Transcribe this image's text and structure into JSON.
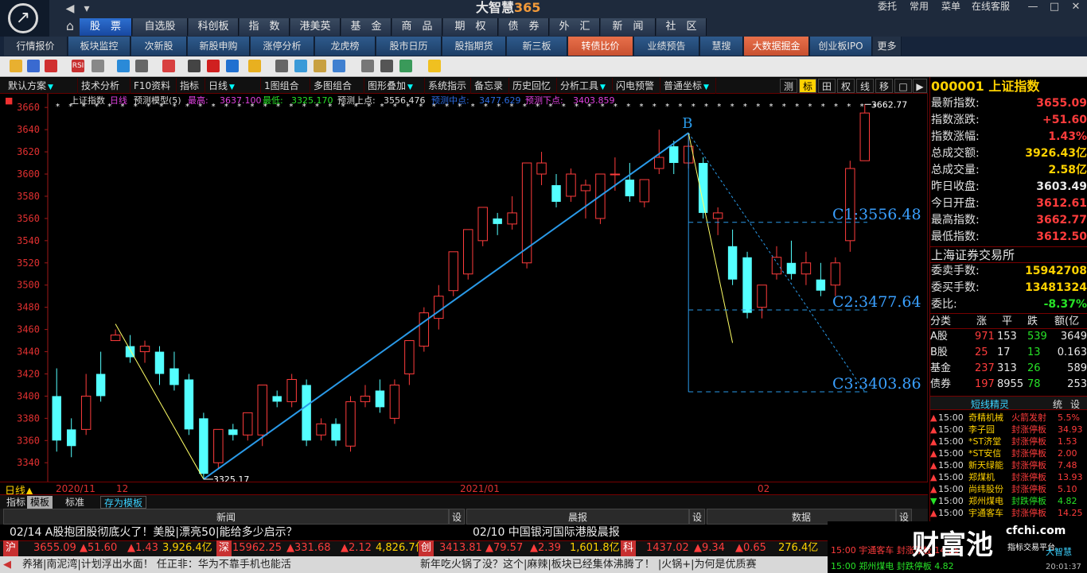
{
  "app": {
    "title_main": "大智慧",
    "title_num": "365",
    "menus": [
      "委托",
      "常用",
      "菜单",
      "在线客服"
    ]
  },
  "nav_tabs": [
    "股　票",
    "自选股",
    "科创板",
    "指　数",
    "港美英",
    "基　金",
    "商　品",
    "期　权",
    "债　券",
    "外　汇",
    "新　闻",
    "社　区"
  ],
  "sub_tabs": [
    "行情报价",
    "板块监控",
    "次新股",
    "新股申购",
    "涨停分析",
    "龙虎榜",
    "股市日历",
    "股指期货",
    "新三板",
    "转债比价",
    "业绩预告",
    "慧搜",
    "大数据掘金",
    "创业板IPO",
    "更多"
  ],
  "chart_toolbar": {
    "items": [
      "默认方案",
      "技术分析",
      "F10资料",
      "指标",
      "日线",
      "1图组合",
      "多图组合",
      "图形叠加",
      "系统指示",
      "备忘录",
      "历史回忆",
      "分析工具",
      "闪电预警",
      "普通坐标"
    ],
    "right_buttons": [
      "测",
      "标",
      "田",
      "权",
      "线",
      "移",
      "□",
      "▶"
    ]
  },
  "chart_header": {
    "name": "上证指数",
    "period": "日线",
    "model": "预测模型(5)",
    "high_label": "最高:",
    "high_val": "3637.100",
    "low_label": "最低:",
    "low_val": "3325.170",
    "up_label": "预测上点:",
    "up_val": "3556.476",
    "mid_label": "预测中点:",
    "mid_val": "3477.629",
    "down_label": "预测下点:",
    "down_val": "3403.859"
  },
  "chart_data": {
    "type": "candlestick",
    "y_ticks": [
      3340,
      3360,
      3380,
      3400,
      3420,
      3440,
      3460,
      3480,
      3500,
      3520,
      3540,
      3560,
      3580,
      3600,
      3620,
      3640,
      3660
    ],
    "ylim": [
      3323,
      3668
    ],
    "x_labels": [
      {
        "text": "日线▲",
        "i": 0
      },
      {
        "text": "2020/11",
        "i": 0
      },
      {
        "text": "12",
        "i": 4
      },
      {
        "text": "2021/01",
        "i": 28
      },
      {
        "text": "02",
        "i": 48
      }
    ],
    "candles": [
      [
        3400,
        3425,
        3360,
        3350
      ],
      [
        3370,
        3380,
        3355,
        3345
      ],
      [
        3370,
        3420,
        3400,
        3365
      ],
      [
        3420,
        3440,
        3400,
        3395
      ],
      [
        3450,
        3460,
        3455,
        3450
      ],
      [
        3445,
        3455,
        3435,
        3430
      ],
      [
        3440,
        3450,
        3445,
        3430
      ],
      [
        3440,
        3445,
        3420,
        3410
      ],
      [
        3425,
        3440,
        3410,
        3405
      ],
      [
        3415,
        3420,
        3370,
        3365
      ],
      [
        3380,
        3385,
        3330,
        3325
      ],
      [
        3340,
        3360,
        3370,
        3335
      ],
      [
        3370,
        3375,
        3365,
        3360
      ],
      [
        3365,
        3375,
        3385,
        3360
      ],
      [
        3365,
        3375,
        3410,
        3355
      ],
      [
        3400,
        3405,
        3395,
        3390
      ],
      [
        3395,
        3420,
        3415,
        3390
      ],
      [
        3410,
        3415,
        3360,
        3355
      ],
      [
        3365,
        3380,
        3375,
        3360
      ],
      [
        3375,
        3380,
        3360,
        3355
      ],
      [
        3355,
        3400,
        3395,
        3350
      ],
      [
        3395,
        3410,
        3400,
        3390
      ],
      [
        3405,
        3415,
        3390,
        3385
      ],
      [
        3380,
        3415,
        3410,
        3375
      ],
      [
        3420,
        3450,
        3450,
        3410
      ],
      [
        3445,
        3480,
        3475,
        3440
      ],
      [
        3470,
        3500,
        3490,
        3460
      ],
      [
        3495,
        3525,
        3530,
        3490
      ],
      [
        3510,
        3550,
        3550,
        3505
      ],
      [
        3540,
        3570,
        3570,
        3535
      ],
      [
        3560,
        3565,
        3555,
        3545
      ],
      [
        3555,
        3580,
        3565,
        3550
      ],
      [
        3520,
        3600,
        3610,
        3515
      ],
      [
        3600,
        3620,
        3610,
        3590
      ],
      [
        3590,
        3600,
        3575,
        3570
      ],
      [
        3580,
        3605,
        3600,
        3575
      ],
      [
        3585,
        3595,
        3590,
        3560
      ],
      [
        3560,
        3580,
        3600,
        3555
      ],
      [
        3600,
        3615,
        3600,
        3585
      ],
      [
        3595,
        3610,
        3580,
        3575
      ],
      [
        3575,
        3595,
        3595,
        3570
      ],
      [
        3605,
        3640,
        3615,
        3600
      ],
      [
        3625,
        3630,
        3610,
        3600
      ],
      [
        3610,
        3637,
        3625,
        3605
      ],
      [
        3610,
        3615,
        3565,
        3560
      ],
      [
        3560,
        3570,
        3565,
        3545
      ],
      [
        3535,
        3550,
        3505,
        3500
      ],
      [
        3525,
        3530,
        3475,
        3470
      ],
      [
        3480,
        3500,
        3500,
        3470
      ],
      [
        3510,
        3535,
        3525,
        3505
      ],
      [
        3520,
        3540,
        3510,
        3505
      ],
      [
        3510,
        3530,
        3520,
        3500
      ],
      [
        3505,
        3520,
        3495,
        3490
      ],
      [
        3500,
        3525,
        3520,
        3490
      ],
      [
        3540,
        3612,
        3605,
        3530
      ],
      [
        3612,
        3663,
        3655,
        3612
      ]
    ],
    "annotations": {
      "A": "A",
      "B": "B",
      "c1": "C1:3556.48",
      "c2": "C2:3477.64",
      "c3": "C3:3403.86",
      "high_tag": "3662.77",
      "low_tag": "3325.17"
    }
  },
  "indicator_tabs": [
    "指标",
    "模板",
    "标准",
    "存为模板"
  ],
  "news": {
    "tabs": [
      "新闻",
      "设",
      "晨报",
      "设",
      "数据",
      "设"
    ],
    "line1": "02/14  A股抱团股彻底火了！美股|漂亮50|能给多少启示？",
    "line2": "02/10  中国银河国际港股晨报"
  },
  "ticker": {
    "sh_label": "沪",
    "sh": {
      "price": "3655.09",
      "chg": "51.60",
      "pct": "1.43",
      "amt": "3,926.4亿"
    },
    "sz_label": "深",
    "sz": {
      "price": "15962.25",
      "chg": "331.68",
      "pct": "2.12",
      "amt": "4,826.7亿"
    },
    "cy_label": "创",
    "cy": {
      "price": "3413.81",
      "chg": "79.57",
      "pct": "2.39",
      "amt": "1,601.8亿"
    },
    "kc_label": "科",
    "kc": {
      "price": "1437.02",
      "chg": "9.34",
      "pct": "0.65",
      "amt": "276.4亿"
    }
  },
  "scroll_news": {
    "left": "养猪|南泥湾|计划浮出水面！  任正非：华为不靠手机也能活",
    "right": "新年吃火锅了没？这个|麻辣|板块已经集体沸腾了！  |火锅+|为何是优质赛"
  },
  "right_panel": {
    "title": "000001 上证指数",
    "rows": [
      {
        "k": "最新指数:",
        "v": "3655.09",
        "c": "red"
      },
      {
        "k": "指数涨跌:",
        "v": "+51.60",
        "c": "red"
      },
      {
        "k": "指数涨幅:",
        "v": "1.43%",
        "c": "red"
      },
      {
        "k": "总成交额:",
        "v": "3926.43亿",
        "c": "yellow"
      },
      {
        "k": "总成交量:",
        "v": "2.58亿",
        "c": "yellow"
      },
      {
        "k": "昨日收盘:",
        "v": "3603.49",
        "c": "white"
      },
      {
        "k": "今日开盘:",
        "v": "3612.61",
        "c": "red"
      },
      {
        "k": "最高指数:",
        "v": "3662.77",
        "c": "red"
      },
      {
        "k": "最低指数:",
        "v": "3612.50",
        "c": "red"
      }
    ],
    "exchange": "上海证券交易所",
    "rows2": [
      {
        "k": "委卖手数:",
        "v": "15942708",
        "c": "yellow"
      },
      {
        "k": "委买手数:",
        "v": "13481324",
        "c": "yellow"
      },
      {
        "k": "委比:",
        "v": "-8.37%",
        "c": "green"
      }
    ],
    "table_head": [
      "分类",
      "涨",
      "平",
      "跌",
      "额(亿"
    ],
    "table": [
      {
        "name": "A股",
        "up": "971",
        "flat": "153",
        "down": "539",
        "amt": "3649"
      },
      {
        "name": "B股",
        "up": "25",
        "flat": "17",
        "down": "13",
        "amt": "0.163"
      },
      {
        "name": "基金",
        "up": "237",
        "flat": "313",
        "down": "26",
        "amt": "589"
      },
      {
        "name": "债券",
        "up": "197",
        "flat": "8955",
        "down": "78",
        "amt": "253"
      }
    ],
    "short_tabs": [
      "短线精灵",
      "统",
      "设"
    ],
    "short_rows": [
      {
        "t": "15:00",
        "n": "奇精机械",
        "e": "火箭发射",
        "v": "5.5%",
        "up": true
      },
      {
        "t": "15:00",
        "n": "李子园",
        "e": "封涨停板",
        "v": "34.93",
        "up": true
      },
      {
        "t": "15:00",
        "n": "*ST济堂",
        "e": "封涨停板",
        "v": "1.53",
        "up": true
      },
      {
        "t": "15:00",
        "n": "*ST安信",
        "e": "封涨停板",
        "v": "2.00",
        "up": true
      },
      {
        "t": "15:00",
        "n": "新天绿能",
        "e": "封涨停板",
        "v": "7.48",
        "up": true
      },
      {
        "t": "15:00",
        "n": "郑煤机",
        "e": "封涨停板",
        "v": "13.93",
        "up": true
      },
      {
        "t": "15:00",
        "n": "尚纬股份",
        "e": "封涨停板",
        "v": "5.10",
        "up": true
      },
      {
        "t": "15:00",
        "n": "郑州煤电",
        "e": "封跌停板",
        "v": "4.82",
        "up": false
      },
      {
        "t": "15:00",
        "n": "宇通客车",
        "e": "封涨停板",
        "v": "14.25",
        "up": true
      }
    ]
  },
  "brand": {
    "name": "财富池",
    "site": "cfchi.com",
    "sub": "指标交易平台",
    "logo": "大智慧",
    "s1": "15:00 宇通客车 封涨停板 14.25",
    "s2": "15:00 郑州煤电 封跌停板 4.82",
    "clock": "20:01:37"
  }
}
